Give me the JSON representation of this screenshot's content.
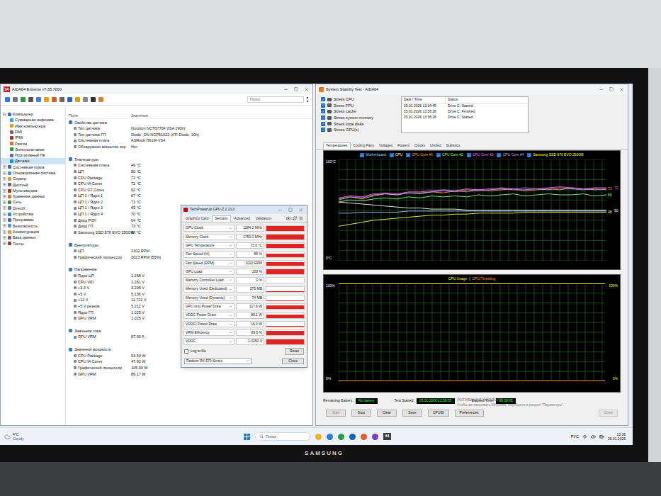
{
  "monitor": {
    "brand": "SAMSUNG"
  },
  "aida": {
    "logo": "64",
    "title": "AIDA64 Extreme v7.35.7000",
    "search": {
      "placeholder": "Поиск"
    },
    "tree": [
      {
        "label": "Компьютер",
        "kind": "group",
        "depth": 0,
        "expanded": true,
        "selected": false
      },
      {
        "label": "Суммарная информа",
        "kind": "leaf",
        "depth": 1,
        "expanded": false,
        "selected": false
      },
      {
        "label": "Имя компьютера",
        "kind": "leaf",
        "depth": 1,
        "expanded": false,
        "selected": false
      },
      {
        "label": "DMI",
        "kind": "leaf",
        "depth": 1,
        "expanded": false,
        "selected": false
      },
      {
        "label": "IPMI",
        "kind": "leaf",
        "depth": 1,
        "expanded": false,
        "selected": false
      },
      {
        "label": "Разгон",
        "kind": "leaf",
        "depth": 1,
        "expanded": false,
        "selected": false
      },
      {
        "label": "Электропитание",
        "kind": "leaf",
        "depth": 1,
        "expanded": false,
        "selected": false
      },
      {
        "label": "Портативный ПК",
        "kind": "leaf",
        "depth": 1,
        "expanded": false,
        "selected": false
      },
      {
        "label": "Датчики",
        "kind": "leaf",
        "depth": 1,
        "expanded": false,
        "selected": true
      },
      {
        "label": "Системная плата",
        "kind": "group",
        "depth": 0,
        "expanded": false,
        "selected": false
      },
      {
        "label": "Операционная система",
        "kind": "group",
        "depth": 0,
        "expanded": false,
        "selected": false
      },
      {
        "label": "Сервер",
        "kind": "group",
        "depth": 0,
        "expanded": false,
        "selected": false
      },
      {
        "label": "Дисплей",
        "kind": "group",
        "depth": 0,
        "expanded": false,
        "selected": false
      },
      {
        "label": "Мультимедиа",
        "kind": "group",
        "depth": 0,
        "expanded": false,
        "selected": false
      },
      {
        "label": "Хранение данных",
        "kind": "group",
        "depth": 0,
        "expanded": false,
        "selected": false
      },
      {
        "label": "Сеть",
        "kind": "group",
        "depth": 0,
        "expanded": false,
        "selected": false
      },
      {
        "label": "DirectX",
        "kind": "group",
        "depth": 0,
        "expanded": false,
        "selected": false
      },
      {
        "label": "Устройства",
        "kind": "group",
        "depth": 0,
        "expanded": false,
        "selected": false
      },
      {
        "label": "Программы",
        "kind": "group",
        "depth": 0,
        "expanded": false,
        "selected": false
      },
      {
        "label": "Безопасность",
        "kind": "group",
        "depth": 0,
        "expanded": false,
        "selected": false
      },
      {
        "label": "Конфигурация",
        "kind": "group",
        "depth": 0,
        "expanded": false,
        "selected": false
      },
      {
        "label": "База данных",
        "kind": "group",
        "depth": 0,
        "expanded": false,
        "selected": false
      },
      {
        "label": "Тесты",
        "kind": "group",
        "depth": 0,
        "expanded": false,
        "selected": false
      }
    ],
    "columns": [
      "Поле",
      "Значение"
    ],
    "sections": [
      {
        "title": "Свойства датчика",
        "rows": [
          {
            "field": "Тип датчика",
            "value": "Nuvoton NCT6776F (ISA 290h)"
          },
          {
            "field": "Тип датчика ГП",
            "value": "Diode, ON NCP81022 (ATI-Diode, 20h)"
          },
          {
            "field": "Системная плата",
            "value": "ASRock H61M-VS4"
          },
          {
            "field": "Обнаружено вскрытие кор",
            "value": "Нет"
          }
        ]
      },
      {
        "title": "Температуры",
        "rows": [
          {
            "field": "Системная плата",
            "value": "49 °C"
          },
          {
            "field": "ЦП",
            "value": "50 °C"
          },
          {
            "field": "CPU Package",
            "value": "72 °C"
          },
          {
            "field": "CPU IA Cores",
            "value": "72 °C"
          },
          {
            "field": "CPU GT Cores",
            "value": "62 °C"
          },
          {
            "field": "ЦП 1 / Ядро 1",
            "value": "67 °C"
          },
          {
            "field": "ЦП 1 / Ядро 2",
            "value": "71 °C"
          },
          {
            "field": "ЦП 1 / Ядро 3",
            "value": "69 °C"
          },
          {
            "field": "ЦП 1 / Ядро 4",
            "value": "70 °C"
          },
          {
            "field": "Диод PCH",
            "value": "64 °C"
          },
          {
            "field": "Диод ГП",
            "value": "73 °C"
          },
          {
            "field": "Samsung SSD 870 EVO 250GB",
            "value": "48 °C"
          }
        ]
      },
      {
        "title": "Вентиляторы",
        "rows": [
          {
            "field": "ЦП",
            "value": "2102 RPM"
          },
          {
            "field": "Графический процессор",
            "value": "2023 RPM  (55%)"
          }
        ]
      },
      {
        "title": "Напряжение",
        "rows": [
          {
            "field": "Ядро ЦП",
            "value": "1.268 V"
          },
          {
            "field": "CPU VID",
            "value": "1.261 V"
          },
          {
            "field": "+3.3 V",
            "value": "3.296 V"
          },
          {
            "field": "+5 V",
            "value": "5.136 V"
          },
          {
            "field": "+12 V",
            "value": "11.722 V"
          },
          {
            "field": "+5 V резерв",
            "value": "5.212 V"
          },
          {
            "field": "Ядро ГП",
            "value": "1.025 V"
          },
          {
            "field": "GPU VRM",
            "value": "1.025 V"
          }
        ]
      },
      {
        "title": "Значения тока",
        "rows": [
          {
            "field": "GPU VRM",
            "value": "87.00 A"
          }
        ]
      },
      {
        "title": "Значения мощности",
        "rows": [
          {
            "field": "CPU Package",
            "value": "53.50 W"
          },
          {
            "field": "CPU IA Cores",
            "value": "47.92 W"
          },
          {
            "field": "Графический процессор",
            "value": "105.00 W"
          },
          {
            "field": "GPU VRM",
            "value": "89.17 W"
          }
        ]
      }
    ]
  },
  "gpuz": {
    "title": "TechPowerUp GPU-Z 2.21.0",
    "tabs": [
      {
        "label": "Graphics Card",
        "selected": false
      },
      {
        "label": "Sensors",
        "selected": true
      },
      {
        "label": "Advanced",
        "selected": false
      },
      {
        "label": "Validation",
        "selected": false
      }
    ],
    "sensors": [
      {
        "label": "GPU Clock",
        "value": "1284.0 MHz",
        "level": 0.9
      },
      {
        "label": "Memory Clock",
        "value": "1750.0 MHz",
        "level": 0.95
      },
      {
        "label": "GPU Temperature",
        "value": "73.0 °C",
        "level": 0.85
      },
      {
        "label": "Fan Speed (%)",
        "value": "55 %",
        "level": 0.7
      },
      {
        "label": "Fan Speed (RPM)",
        "value": "2022 RPM",
        "level": 0.75
      },
      {
        "label": "GPU Load",
        "value": "100 %",
        "level": 1
      },
      {
        "label": "Memory Controller Load",
        "value": "0 %",
        "level": 0
      },
      {
        "label": "Memory Used (Dedicated)",
        "value": "275 MB",
        "level": 0.06
      },
      {
        "label": "Memory Used (Dynamic)",
        "value": "74 MB",
        "level": 0.03
      },
      {
        "label": "GPU only Power Draw",
        "value": "117.6 W",
        "level": 0.8
      },
      {
        "label": "VDDC Power Draw",
        "value": "89.1 W",
        "level": 0.7
      },
      {
        "label": "VDDCI Power Draw",
        "value": "16.0 W",
        "level": 0.2
      },
      {
        "label": "VRM Efficiency",
        "value": "89.5 %",
        "level": 0.85
      },
      {
        "label": "VDDC",
        "value": "1.0250 V",
        "level": 0.9
      }
    ],
    "log_to_file": {
      "label": "Log to file",
      "checked": false
    },
    "reset": "Reset",
    "device": "Radeon RX 570 Series",
    "close": "Close"
  },
  "stability": {
    "title": "System Stability Test - AIDA64",
    "stress": [
      {
        "label": "Stress CPU",
        "checked": true
      },
      {
        "label": "Stress FPU",
        "checked": true
      },
      {
        "label": "Stress cache",
        "checked": true
      },
      {
        "label": "Stress system memory",
        "checked": true
      },
      {
        "label": "Stress local disks",
        "checked": true
      },
      {
        "label": "Stress GPU(s)",
        "checked": true
      }
    ],
    "log": {
      "columns": [
        "Date / Time",
        "Status"
      ],
      "rows": [
        {
          "time": "25.01.2026 13:34:45",
          "status": "Drive C: Started"
        },
        {
          "time": "25.01.2026 13:36:18",
          "status": "Drive C: Finished"
        },
        {
          "time": "25.01.2026 13:36:18",
          "status": "Drive C: Started"
        }
      ]
    },
    "tabs": [
      {
        "label": "Temperatures",
        "selected": true
      },
      {
        "label": "Cooling Fans",
        "selected": false
      },
      {
        "label": "Voltages",
        "selected": false
      },
      {
        "label": "Powers",
        "selected": false
      },
      {
        "label": "Clocks",
        "selected": false
      },
      {
        "label": "Unified",
        "selected": false
      },
      {
        "label": "Statistics",
        "selected": false
      }
    ],
    "temp_chart": {
      "y_max": "100°C",
      "y_min": "0°C",
      "series": [
        {
          "name": "Motherboard",
          "checked": true,
          "color": "#9ad0ff",
          "values": [
            47,
            47,
            48,
            48,
            48,
            48,
            49,
            49,
            49,
            49,
            49,
            49,
            49,
            49,
            49,
            49,
            49,
            49,
            49,
            49,
            49,
            49,
            49,
            49
          ]
        },
        {
          "name": "CPU",
          "checked": true,
          "color": "#ffffff",
          "values": [
            58,
            57,
            56,
            55,
            54,
            53,
            52,
            52,
            51,
            51,
            51,
            50,
            50,
            50,
            50,
            50,
            50,
            50,
            50,
            50,
            50,
            50,
            50,
            50
          ]
        },
        {
          "name": "CPU Core #1",
          "checked": true,
          "color": "#ffa040",
          "values": [
            60,
            63,
            61,
            64,
            66,
            65,
            67,
            66,
            68,
            67,
            69,
            68,
            70,
            69,
            70,
            71,
            69,
            70,
            71,
            70,
            72,
            71,
            70,
            71
          ]
        },
        {
          "name": "CPU Core #2",
          "checked": true,
          "color": "#80ff80",
          "values": [
            58,
            60,
            59,
            61,
            62,
            61,
            63,
            62,
            64,
            63,
            64,
            63,
            65,
            64,
            65,
            66,
            64,
            65,
            66,
            65,
            65,
            66,
            64,
            65
          ]
        },
        {
          "name": "CPU Core #3",
          "checked": true,
          "color": "#ff66ff",
          "values": [
            62,
            64,
            63,
            66,
            67,
            66,
            68,
            68,
            69,
            70,
            69,
            71,
            70,
            71,
            72,
            71,
            72,
            71,
            72,
            73,
            72,
            71,
            72,
            72
          ]
        },
        {
          "name": "CPU Core #4",
          "checked": true,
          "color": "#b0a0ff",
          "values": [
            61,
            63,
            62,
            65,
            66,
            65,
            67,
            67,
            68,
            69,
            68,
            70,
            69,
            70,
            71,
            70,
            70,
            71,
            70,
            72,
            71,
            70,
            71,
            70
          ]
        },
        {
          "name": "Samsung SSD 870 EVO 250GB",
          "checked": true,
          "color": "#ffff40",
          "values": [
            34,
            36,
            38,
            40,
            41,
            42,
            43,
            44,
            45,
            45,
            46,
            46,
            47,
            47,
            47,
            47,
            48,
            48,
            48,
            48,
            48,
            48,
            48,
            48
          ]
        }
      ],
      "end_labels": [
        {
          "text": "71",
          "color": "#ffa040"
        },
        {
          "text": "72",
          "color": "#ff66ff"
        },
        {
          "text": "65",
          "color": "#80ff80"
        },
        {
          "text": "50",
          "color": "#ffffff"
        },
        {
          "text": "48",
          "color": "#ffff40"
        }
      ]
    },
    "cpu_chart": {
      "separator": "|",
      "y_max_left": "100%",
      "y_min_left": "0%",
      "y_max_right": "100%",
      "y_min_right": "0%",
      "series": [
        {
          "name": "CPU Usage",
          "color": "#ffff00",
          "values": [
            100,
            100,
            100,
            100,
            100,
            100,
            100,
            100,
            100,
            100,
            100,
            100,
            100,
            100,
            100,
            100,
            100,
            100,
            100,
            100,
            100,
            100,
            100,
            100
          ]
        },
        {
          "name": "CPU Throttling",
          "color": "#ff9933",
          "values": [
            0,
            0,
            0,
            0,
            0,
            0,
            0,
            0,
            0,
            0,
            0,
            0,
            0,
            0,
            0,
            0,
            0,
            0,
            0,
            0,
            0,
            0,
            0,
            0
          ]
        }
      ]
    },
    "info": [
      {
        "label": "Remaining Battery:",
        "value": "No battery"
      },
      {
        "label": "Test Started:",
        "value": "25.01.2026 12:58:55"
      },
      {
        "label": "Elapsed Time:",
        "value": "00:38:05"
      }
    ],
    "buttons": [
      {
        "label": "Start",
        "disabled": true
      },
      {
        "label": "Stop",
        "disabled": false
      },
      {
        "label": "Clear",
        "disabled": false
      },
      {
        "label": "Save",
        "disabled": false
      },
      {
        "label": "CPUID",
        "disabled": false
      },
      {
        "label": "Preferences",
        "disabled": false
      }
    ],
    "close": {
      "label": "Close",
      "disabled": true
    }
  },
  "watermark": {
    "title": "Активация Windows",
    "text": "Чтобы активировать Windows, перейдите в раздел \"Параметры\"."
  },
  "taskbar": {
    "weather": {
      "temp": "4°C",
      "condition": "Cloudy"
    },
    "search": {
      "placeholder": "Поиск"
    },
    "app_badge": "64",
    "language": "РУС",
    "time": "13:36",
    "date": "25.01.2026"
  }
}
